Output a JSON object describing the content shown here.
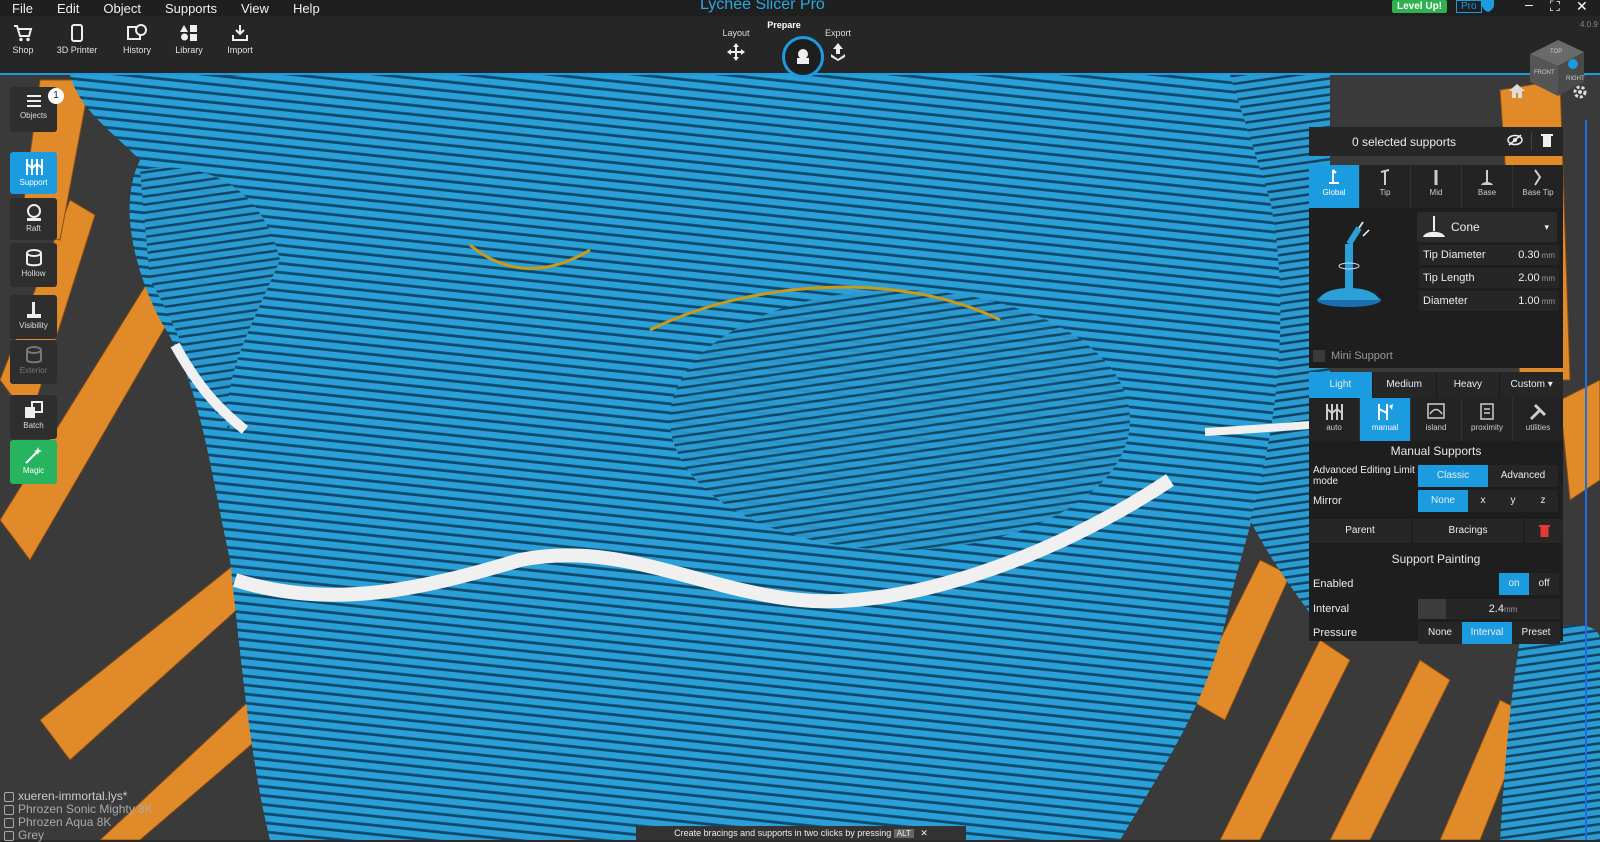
{
  "app_title": "Lychee Slicer Pro",
  "menu": [
    "File",
    "Edit",
    "Object",
    "Supports",
    "View",
    "Help"
  ],
  "toolbar": {
    "buttons": [
      "Shop",
      "3D Printer",
      "History",
      "Library",
      "Import"
    ]
  },
  "modes": {
    "layout": "Layout",
    "prepare": "Prepare",
    "export": "Export"
  },
  "badges": {
    "levelup": "Level Up!",
    "pro": "Pro"
  },
  "version": "4.0.9",
  "navcube": {
    "top": "TOP",
    "front": "FRONT",
    "right": "RIGHT"
  },
  "left_panel": {
    "objects": "Objects",
    "objects_count": "1",
    "support": "Support",
    "raft": "Raft",
    "hollow": "Hollow",
    "visibility": "Visibility",
    "exterior": "Exterior",
    "batch": "Batch",
    "magic": "Magic"
  },
  "right_panel": {
    "selected_supports": "0 selected supports",
    "support_tabs": [
      "Global",
      "Tip",
      "Mid",
      "Base",
      "Base Tip"
    ],
    "tip_shape": "Cone",
    "params": [
      {
        "label": "Tip Diameter",
        "value": "0.30",
        "unit": "mm"
      },
      {
        "label": "Tip Length",
        "value": "2.00",
        "unit": "mm"
      },
      {
        "label": "Diameter",
        "value": "1.00",
        "unit": "mm"
      }
    ],
    "mini_support": "Mini Support",
    "density": [
      "Light",
      "Medium",
      "Heavy",
      "Custom"
    ],
    "density_active": "Light",
    "mode_tabs": [
      "auto",
      "manual",
      "island",
      "proximity",
      "utilities"
    ],
    "mode_active": "manual",
    "manual_title": "Manual Supports",
    "adv_label": "Advanced Editing Limit mode",
    "adv_options": [
      "Classic",
      "Advanced"
    ],
    "mirror_label": "Mirror",
    "mirror_options": [
      "None",
      "x",
      "y",
      "z"
    ],
    "parent": "Parent",
    "bracings": "Bracings",
    "painting_title": "Support Painting",
    "enabled_label": "Enabled",
    "enabled_options": [
      "on",
      "off"
    ],
    "interval_label": "Interval",
    "interval_value": "2.4",
    "interval_unit": "mm",
    "pressure_label": "Pressure",
    "pressure_options": [
      "None",
      "Interval",
      "Preset"
    ]
  },
  "bottom_info": [
    "xueren-immortal.lys*",
    "Phrozen Sonic Mighty 8K",
    "Phrozen Aqua 8K",
    "Grey"
  ],
  "hint": "Create bracings and supports in two clicks by pressing",
  "hint_key": "ALT",
  "colors": {
    "accent": "#1b9be0",
    "model": "#2a9fd8",
    "supports": "#e08a2a",
    "magic": "#26b45f"
  }
}
